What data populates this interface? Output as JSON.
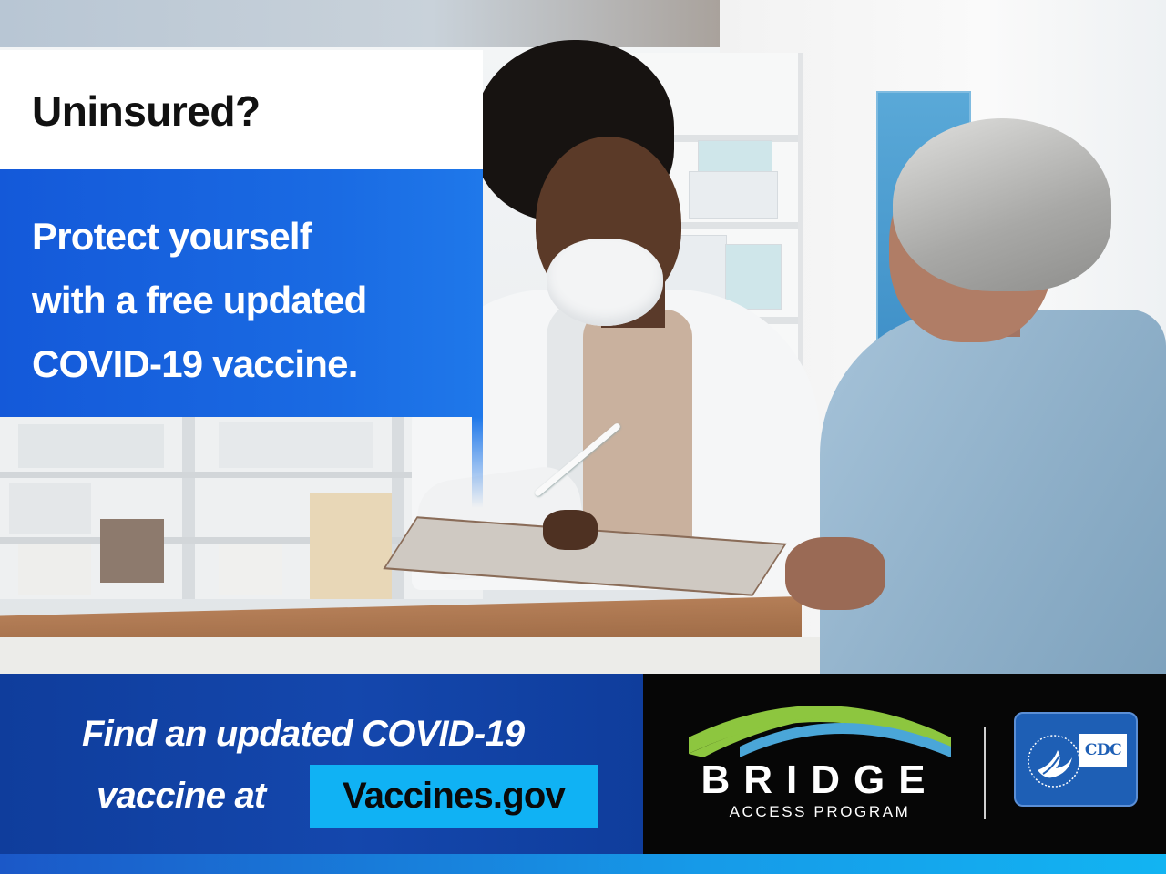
{
  "headline": {
    "question": "Uninsured?",
    "lines": [
      "Protect yourself",
      "with a free updated",
      "COVID-19 vaccine."
    ]
  },
  "cta": {
    "line1": "Find an updated COVID-19",
    "line2_prefix": "vaccine at",
    "link_text": "Vaccines.gov"
  },
  "logos": {
    "bridge_word": "BRIDGE",
    "bridge_sub": "ACCESS PROGRAM",
    "cdc_text": "CDC",
    "hhs_seal_icon": "hhs-eagle-seal"
  },
  "colors": {
    "headline_blue": "#1a6be3",
    "bottom_blue": "#1447ad",
    "link_bg": "#10b2f4",
    "bridge_green": "#8dc63f",
    "bridge_blue": "#4aa6d8",
    "cdc_blue": "#1e5fb5"
  }
}
